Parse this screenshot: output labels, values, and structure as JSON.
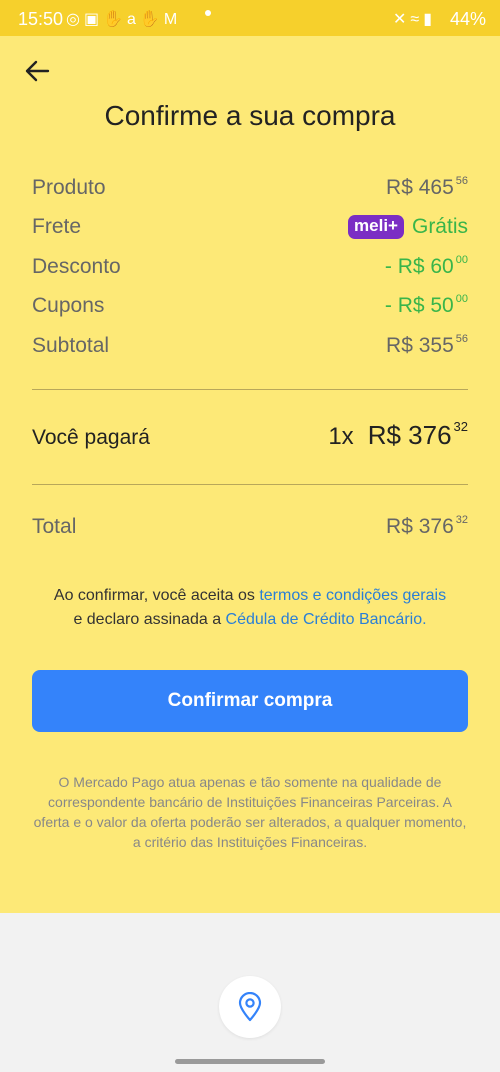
{
  "status_bar": {
    "time": "15:50",
    "notification_icons": [
      "whatsapp-icon",
      "instagram-icon",
      "hand-icon",
      "amazon-icon",
      "hand-icon",
      "gmail-icon"
    ],
    "battery": "44%"
  },
  "page": {
    "title": "Confirme a sua compra"
  },
  "summary": {
    "produto": {
      "label": "Produto",
      "value": "R$ 465",
      "cents": "56"
    },
    "frete": {
      "label": "Frete",
      "badge": "meli+",
      "value": "Grátis"
    },
    "desconto": {
      "label": "Desconto",
      "value": "- R$ 60",
      "cents": "00"
    },
    "cupons": {
      "label": "Cupons",
      "value": "- R$ 50",
      "cents": "00"
    },
    "subtotal": {
      "label": "Subtotal",
      "value": "R$ 355",
      "cents": "56"
    }
  },
  "payment": {
    "label": "Você pagará",
    "installments": "1x",
    "value": "R$ 376",
    "cents": "32"
  },
  "total": {
    "label": "Total",
    "value": "R$ 376",
    "cents": "32"
  },
  "legal": {
    "text1": "Ao confirmar, você aceita os ",
    "link1": "termos e condições gerais",
    "text2": "e declaro assinada a ",
    "link2": "Cédula de Crédito Bancário."
  },
  "confirm_button": "Confirmar compra",
  "disclaimer": "O Mercado Pago atua apenas e tão somente na qualidade de correspondente bancário de Instituições Financeiras Parceiras. A oferta e o valor da oferta poderão ser alterados, a qualquer momento, a critério das Instituições Financeiras.",
  "colors": {
    "background": "#fde977",
    "status_bar": "#f6d02c",
    "primary_button": "#3483fa",
    "green": "#39b54a",
    "meli_badge": "#7b2ec4",
    "link": "#2a7fd6"
  }
}
